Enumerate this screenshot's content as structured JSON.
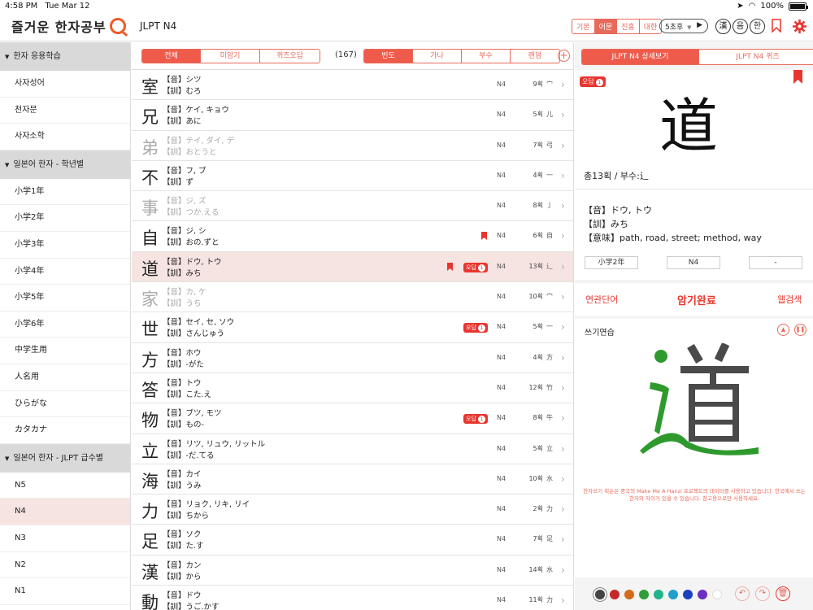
{
  "status": {
    "time": "4:58 PM",
    "date": "Tue Mar 12",
    "battery": "100%"
  },
  "app": {
    "title_part1": "즐거운 한자공부",
    "level_title": "JLPT N4"
  },
  "top_segments": [
    {
      "label": "기본",
      "active": false
    },
    {
      "label": "어문",
      "active": true
    },
    {
      "label": "진흥",
      "active": false
    },
    {
      "label": "대한",
      "active": false
    }
  ],
  "timer": {
    "label": "5초후"
  },
  "top_buttons": {
    "han": "漢",
    "eum": "음",
    "hangul": "한"
  },
  "sidebar": {
    "sections": [
      {
        "title": "한자 응용학습",
        "items": [
          "사자성어",
          "천자문",
          "사자소학"
        ]
      },
      {
        "title": "일본어 한자 - 학년별",
        "items": [
          "小学1年",
          "小学2年",
          "小学3年",
          "小学4年",
          "小学5年",
          "小学6年",
          "中学生用",
          "人名用",
          "ひらがな",
          "カタカナ"
        ]
      },
      {
        "title": "일본어 한자 - JLPT 급수별",
        "items": [
          "N5",
          "N4",
          "N3",
          "N2",
          "N1"
        ]
      }
    ],
    "selected": "N4"
  },
  "filters": {
    "group1": [
      "전체",
      "미암기",
      "퀴즈오답"
    ],
    "count": "(167)",
    "group2": [
      "빈도",
      "가나",
      "부수",
      "랜덤"
    ]
  },
  "rows": [
    {
      "kanji": "室",
      "on": "【音】シツ",
      "kun": "【訓】むろ",
      "level": "N4",
      "strokes": "9획",
      "radical": "宀",
      "dim": false,
      "bookmark": false,
      "wrong": ""
    },
    {
      "kanji": "兄",
      "on": "【音】ケイ, キョウ",
      "kun": "【訓】あに",
      "level": "N4",
      "strokes": "5획",
      "radical": "儿",
      "dim": false,
      "bookmark": false,
      "wrong": ""
    },
    {
      "kanji": "弟",
      "on": "【音】テイ, ダイ, デ",
      "kun": "【訓】おとうと",
      "level": "N4",
      "strokes": "7획",
      "radical": "弓",
      "dim": true,
      "bookmark": false,
      "wrong": ""
    },
    {
      "kanji": "不",
      "on": "【音】フ, ブ",
      "kun": "【訓】ず",
      "level": "N4",
      "strokes": "4획",
      "radical": "一",
      "dim": false,
      "bookmark": false,
      "wrong": ""
    },
    {
      "kanji": "事",
      "on": "【音】ジ, ズ",
      "kun": "【訓】つか.える",
      "level": "N4",
      "strokes": "8획",
      "radical": "亅",
      "dim": true,
      "bookmark": false,
      "wrong": ""
    },
    {
      "kanji": "自",
      "on": "【音】ジ, シ",
      "kun": "【訓】おの.ずと",
      "level": "N4",
      "strokes": "6획",
      "radical": "自",
      "dim": false,
      "bookmark": true,
      "wrong": ""
    },
    {
      "kanji": "道",
      "on": "【音】ドウ, トウ",
      "kun": "【訓】みち",
      "level": "N4",
      "strokes": "13획",
      "radical": "辶",
      "dim": false,
      "bookmark": true,
      "wrong": "오답",
      "wrong_count": "1",
      "selected": true
    },
    {
      "kanji": "家",
      "on": "【音】カ, ケ",
      "kun": "【訓】うち",
      "level": "N4",
      "strokes": "10획",
      "radical": "宀",
      "dim": true,
      "bookmark": false,
      "wrong": ""
    },
    {
      "kanji": "世",
      "on": "【音】セイ, セ, ソウ",
      "kun": "【訓】さんじゅう",
      "level": "N4",
      "strokes": "5획",
      "radical": "一",
      "dim": false,
      "bookmark": false,
      "wrong": "오답",
      "wrong_count": "1"
    },
    {
      "kanji": "方",
      "on": "【音】ホウ",
      "kun": "【訓】-がた",
      "level": "N4",
      "strokes": "4획",
      "radical": "方",
      "dim": false,
      "bookmark": false,
      "wrong": ""
    },
    {
      "kanji": "答",
      "on": "【音】トウ",
      "kun": "【訓】こた.え",
      "level": "N4",
      "strokes": "12획",
      "radical": "竹",
      "dim": false,
      "bookmark": false,
      "wrong": ""
    },
    {
      "kanji": "物",
      "on": "【音】ブツ, モツ",
      "kun": "【訓】もの-",
      "level": "N4",
      "strokes": "8획",
      "radical": "牛",
      "dim": false,
      "bookmark": false,
      "wrong": "오답",
      "wrong_count": "1"
    },
    {
      "kanji": "立",
      "on": "【音】リツ, リュウ, リットル",
      "kun": "【訓】-だ.てる",
      "level": "N4",
      "strokes": "5획",
      "radical": "立",
      "dim": false,
      "bookmark": false,
      "wrong": ""
    },
    {
      "kanji": "海",
      "on": "【音】カイ",
      "kun": "【訓】うみ",
      "level": "N4",
      "strokes": "10획",
      "radical": "水",
      "dim": false,
      "bookmark": false,
      "wrong": ""
    },
    {
      "kanji": "力",
      "on": "【音】リョク, リキ, リイ",
      "kun": "【訓】ちから",
      "level": "N4",
      "strokes": "2획",
      "radical": "力",
      "dim": false,
      "bookmark": false,
      "wrong": ""
    },
    {
      "kanji": "足",
      "on": "【音】ソク",
      "kun": "【訓】た.す",
      "level": "N4",
      "strokes": "7획",
      "radical": "足",
      "dim": false,
      "bookmark": false,
      "wrong": ""
    },
    {
      "kanji": "漢",
      "on": "【音】カン",
      "kun": "【訓】から",
      "level": "N4",
      "strokes": "14획",
      "radical": "水",
      "dim": false,
      "bookmark": false,
      "wrong": ""
    },
    {
      "kanji": "動",
      "on": "【音】ドウ",
      "kun": "【訓】うご.かす",
      "level": "N4",
      "strokes": "11획",
      "radical": "力",
      "dim": false,
      "bookmark": false,
      "wrong": ""
    }
  ],
  "detail": {
    "tabs": [
      "JLPT N4 상세보기",
      "JLPT N4 퀴즈"
    ],
    "wrong_label": "오답",
    "wrong_count": "1",
    "kanji": "道",
    "info": "총13획 / 부수:辶",
    "on": "【音】ドウ, トウ",
    "kun": "【訓】みち",
    "meaning": "【意味】path, road, street; method, way",
    "chips": [
      "小学2年",
      "N4",
      "-"
    ],
    "actions": {
      "related": "연관단어",
      "memorized": "암기완료",
      "web": "웹검색"
    },
    "practice_title": "쓰기연습",
    "practice_note": "한자쓰기 획순은 중국의 Make Me A Hanzi 프로젝트의 데이터를 사용하고 있습니다. 한국에서 쓰는 한자와 차이가 있을 수 있습니다. 참고용으로만 사용하세요."
  },
  "palette": [
    "#444444",
    "#c62828",
    "#d66a1a",
    "#2e9e3a",
    "#1fb48a",
    "#1ea0c8",
    "#1a3fc0",
    "#6a2fc0",
    "#ffffff"
  ],
  "colors": {
    "accent": "#e86a5a",
    "red": "#e8352e"
  }
}
